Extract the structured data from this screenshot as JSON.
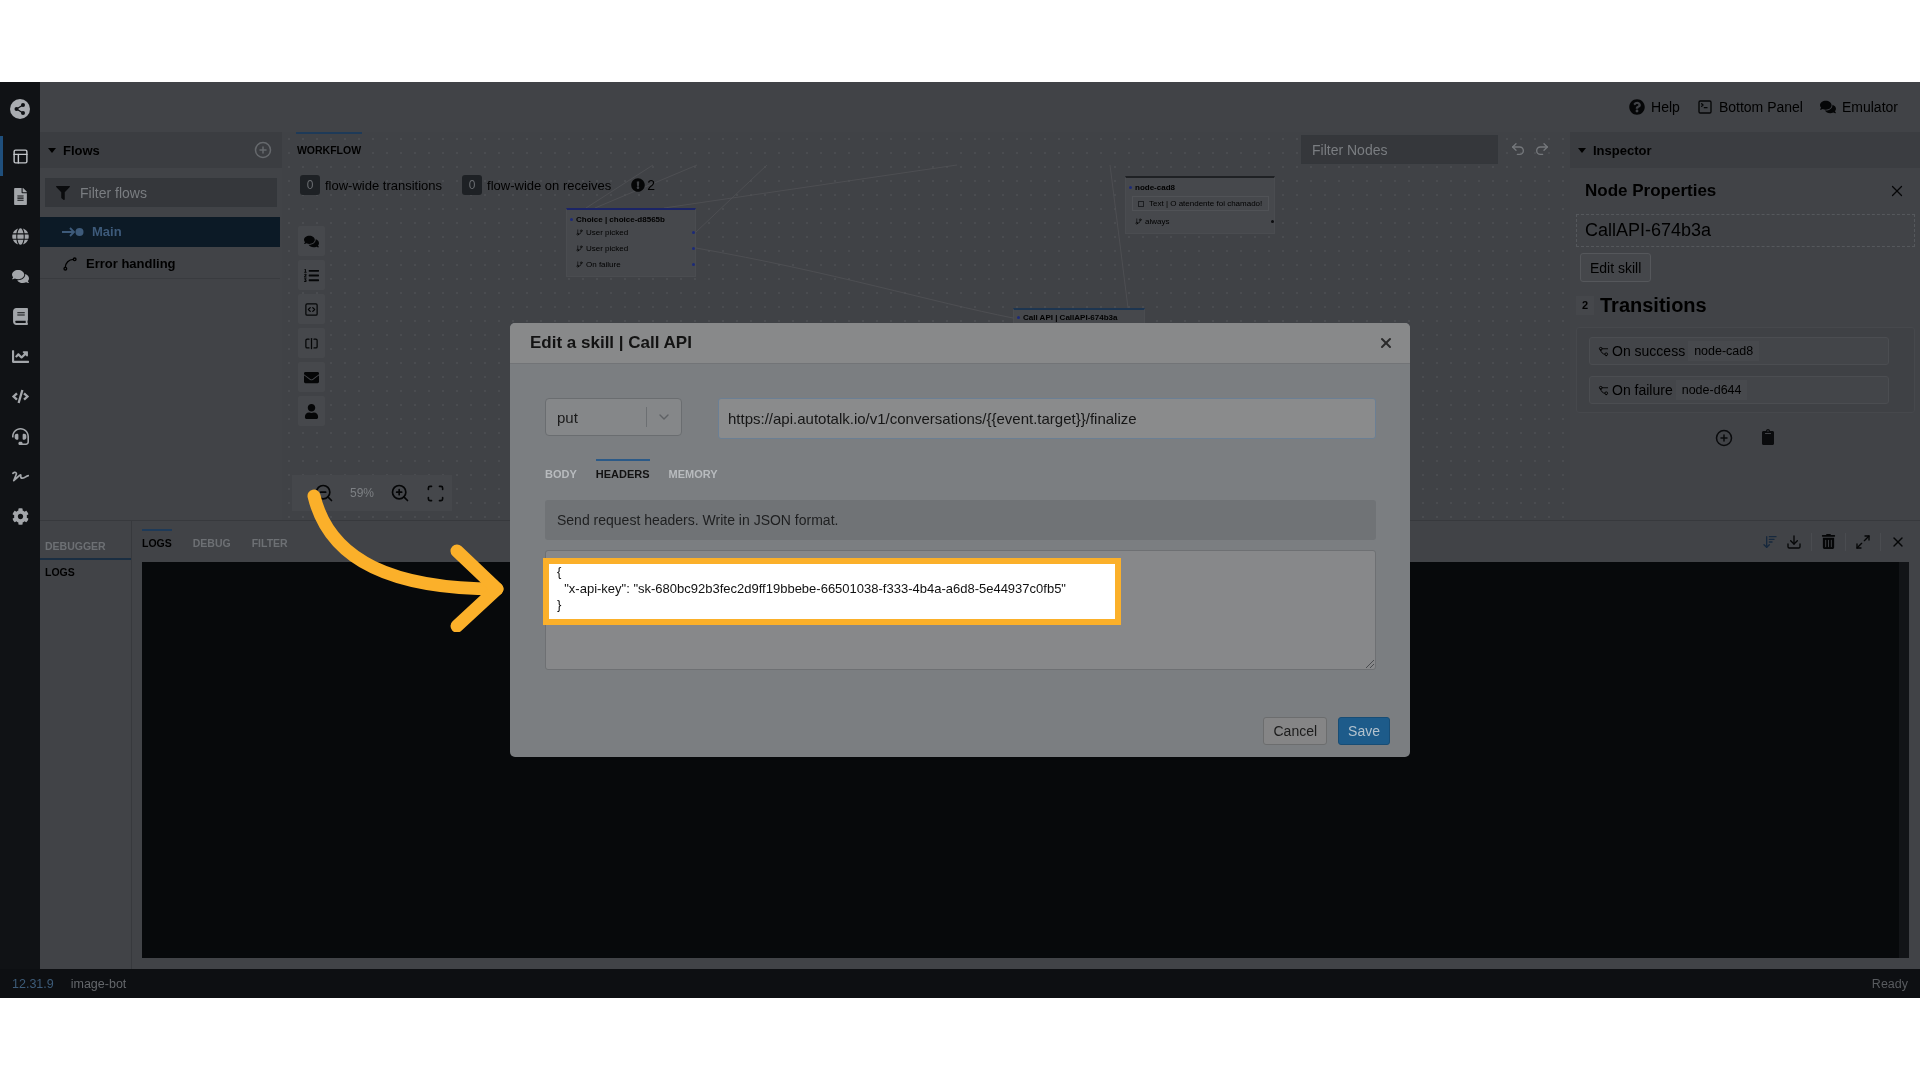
{
  "rail": {
    "items": [
      {
        "selected": true
      },
      {
        "selected": false
      },
      {
        "selected": false
      },
      {
        "selected": false
      },
      {
        "selected": false
      },
      {
        "selected": false
      },
      {
        "selected": false
      },
      {
        "selected": false
      },
      {
        "selected": false
      },
      {
        "selected": false
      }
    ]
  },
  "top_actions": [
    {
      "label": "Help"
    },
    {
      "label": "Bottom Panel"
    },
    {
      "label": "Emulator"
    }
  ],
  "flows": {
    "title": "Flows",
    "filter": {
      "placeholder": "Filter flows"
    },
    "items": [
      {
        "label": "Main",
        "selected": true
      },
      {
        "label": "Error handling",
        "selected": false
      }
    ]
  },
  "workflow": {
    "tabs": [
      {
        "label": "WORKFLOW",
        "selected": true
      }
    ],
    "badges": [
      {
        "count": "0",
        "label": "flow-wide transitions"
      },
      {
        "count": "0",
        "label": "flow-wide on receives"
      }
    ],
    "warnings": "2",
    "filter": {
      "placeholder": "Filter Nodes"
    },
    "zoom": "59%",
    "nodes": [
      {
        "title": "Choice | choice-d8565b",
        "rows": [
          "User picked",
          "User picked",
          "On failure"
        ]
      },
      {
        "title": "node-cad8",
        "items": [
          "Text | O atendente foi chamado!"
        ],
        "rows": [
          "always"
        ]
      },
      {
        "title": "Call API | CallAPI-674b3a"
      }
    ]
  },
  "inspector": {
    "title": "Inspector",
    "heading": "Node Properties",
    "node_name": "CallAPI-674b3a",
    "edit_button": "Edit skill",
    "transitions": {
      "count": "2",
      "title": "Transitions",
      "items": [
        {
          "label": "On success",
          "target": "node-cad8"
        },
        {
          "label": "On failure",
          "target": "node-d644"
        }
      ]
    }
  },
  "bottom_panel": {
    "side_tabs": [
      {
        "label": "DEBUGGER",
        "selected": true
      }
    ],
    "side_items": [
      "LOGS"
    ],
    "tabs": [
      {
        "label": "LOGS",
        "selected": true
      },
      {
        "label": "DEBUG",
        "selected": false
      },
      {
        "label": "FILTER",
        "selected": false
      }
    ]
  },
  "status_bar": {
    "version": "12.31.9",
    "bot": "image-bot",
    "status": "Ready"
  },
  "modal": {
    "title": "Edit a skill | Call API",
    "method": "put",
    "url": "https://api.autotalk.io/v1/conversations/{{event.target}}/finalize",
    "tabs": [
      {
        "label": "BODY",
        "selected": false
      },
      {
        "label": "HEADERS",
        "selected": true
      },
      {
        "label": "MEMORY",
        "selected": false
      }
    ],
    "hint": "Send request headers. Write in JSON format.",
    "headers": "{\n  \"x-api-key\": \"sk-680bc92b3fec2d9ff19bbebe-66501038-f333-4b4a-a6d8-5e44937c0fb5\"\n}",
    "buttons": [
      {
        "label": "Cancel",
        "kind": "secondary"
      },
      {
        "label": "Save",
        "kind": "primary"
      }
    ]
  },
  "callout": {
    "arrow": true,
    "highlight": true
  }
}
